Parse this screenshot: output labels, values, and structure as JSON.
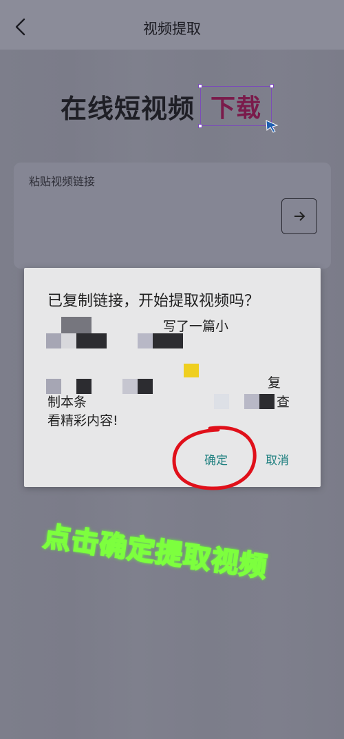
{
  "header": {
    "title": "视频提取"
  },
  "hero": {
    "text": "在线短视频",
    "highlight": "下载"
  },
  "input": {
    "placeholder": "粘贴视频链接"
  },
  "dialog": {
    "title": "已复制链接，开始提取视频吗？",
    "fragments": {
      "line1": "写了一篇小",
      "line3_right": "复",
      "line4_left": "制本条",
      "line4_right": "查",
      "line5": "看精彩内容!"
    },
    "confirm_label": "确定",
    "cancel_label": "取消"
  },
  "annotation": {
    "text": "点击确定提取视频"
  },
  "colors": {
    "dialog_button": "#1e7f7f",
    "annotation_text": "#d12a8a",
    "annotation_outline": "#7dff3e",
    "circle": "#e0101a"
  }
}
